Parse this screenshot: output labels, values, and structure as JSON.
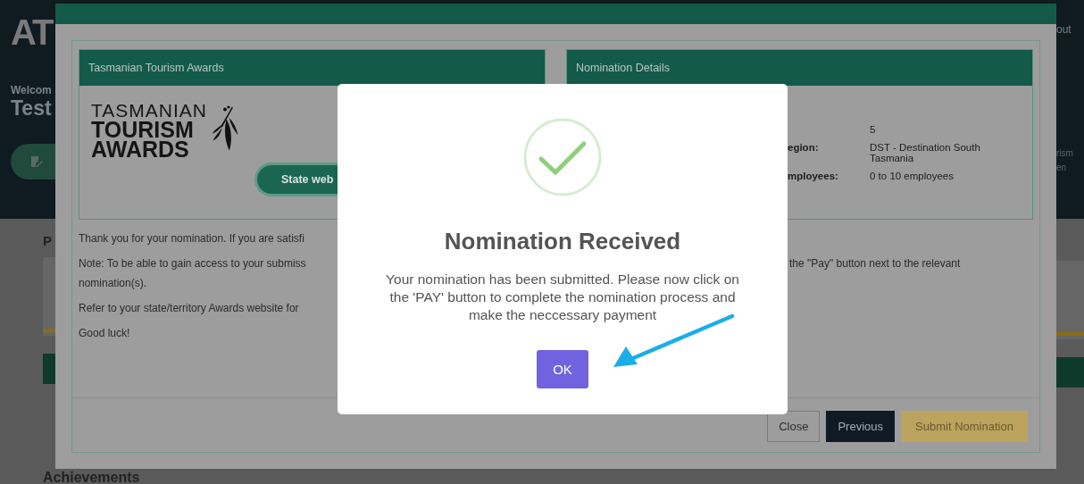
{
  "background_page": {
    "logo": "AT",
    "header_link": "out",
    "welcome": "Welcom",
    "user_name": "Test",
    "side_texts": [
      "rism",
      "en"
    ],
    "section_heading": "P",
    "achievements_heading": "Achievements"
  },
  "nomination_modal": {
    "awards_panel": {
      "title": "Tasmanian Tourism Awards",
      "logo_lines": [
        "TASMANIAN",
        "TOURISM",
        "AWARDS"
      ],
      "website_button": "State web"
    },
    "details_panel": {
      "title": "Nomination Details",
      "rows": [
        {
          "value": "5"
        },
        {
          "label": "egion:",
          "value": "DST - Destination South Tasmania"
        },
        {
          "label": "mployees:",
          "value": "0 to 10 employees"
        }
      ]
    },
    "paragraphs": [
      {
        "lines": [
          {
            "left": "Thank you for your nomination. If you are satisfi"
          }
        ]
      },
      {
        "lines": [
          {
            "left": "Note: To be able to gain access to your submiss",
            "right": "the \"Pay\" button next to the relevant"
          },
          {
            "left": "nomination(s)."
          }
        ]
      },
      {
        "lines": [
          {
            "left": "Refer to your state/territory Awards website for"
          }
        ]
      },
      {
        "lines": [
          {
            "left": "Good luck!"
          }
        ]
      }
    ],
    "buttons": [
      {
        "label": "Close",
        "kind": "outline"
      },
      {
        "label": "Previous",
        "kind": "dark"
      },
      {
        "label": "Submit Nomination",
        "kind": "primary"
      }
    ]
  },
  "alert": {
    "title": "Nomination Received",
    "message": "Your nomination has been submitted. Please now click on the 'PAY' button to complete the nomination process and make the neccessary payment",
    "ok_button": "OK"
  }
}
